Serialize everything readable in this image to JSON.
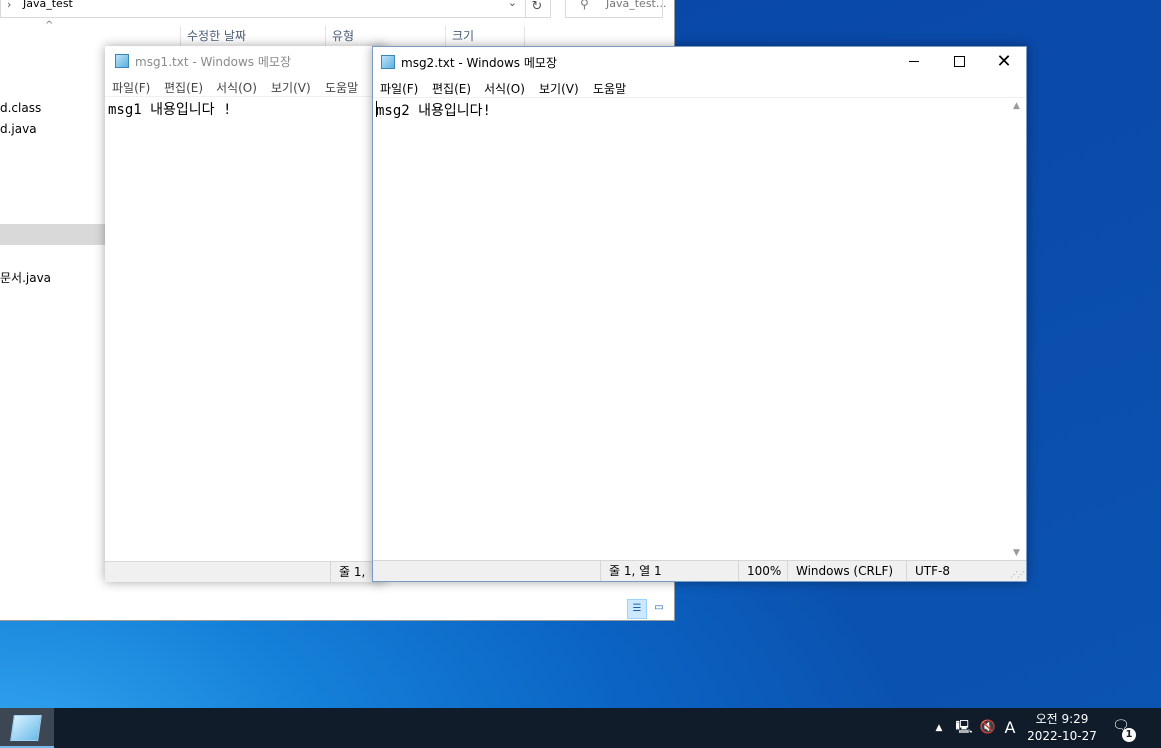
{
  "explorer": {
    "path": "Java_test",
    "search_placeholder": "Java_test...",
    "columns": {
      "modified": "수정한 날짜",
      "type": "유형",
      "size": "크기"
    },
    "files": [
      {
        "name": "d.class"
      },
      {
        "name": "d.java"
      },
      {
        "name": "문서.java"
      }
    ]
  },
  "notepad1": {
    "title": "msg1.txt - Windows 메모장",
    "menu": [
      "파일(F)",
      "편집(E)",
      "서식(O)",
      "보기(V)",
      "도움말"
    ],
    "content": "msg1 내용입니다 !",
    "status": {
      "position": "줄 1,"
    }
  },
  "notepad2": {
    "title": "msg2.txt - Windows 메모장",
    "menu": [
      "파일(F)",
      "편집(E)",
      "서식(O)",
      "보기(V)",
      "도움말"
    ],
    "content": "msg2 내용입니다!",
    "status": {
      "position": "줄 1, 열 1",
      "zoom": "100%",
      "line_ending": "Windows (CRLF)",
      "encoding": "UTF-8"
    }
  },
  "taskbar": {
    "ime": "A",
    "time": "오전 9:29",
    "date": "2022-10-27",
    "notification_count": "1"
  }
}
